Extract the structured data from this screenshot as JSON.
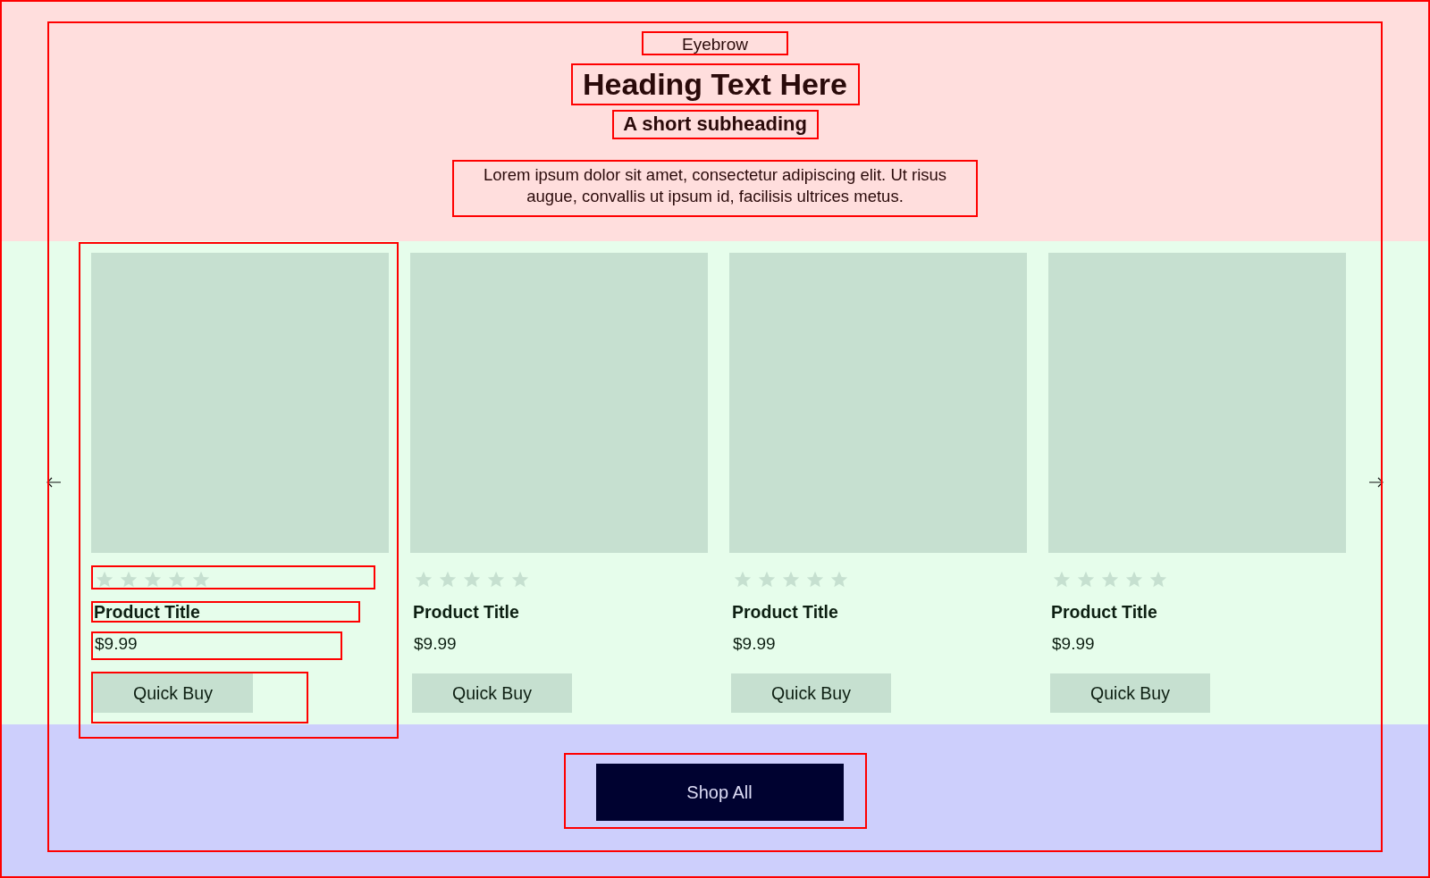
{
  "header": {
    "eyebrow": "Eyebrow",
    "heading": "Heading Text Here",
    "subheading": "A short subheading",
    "body": "Lorem ipsum dolor sit amet, consectetur adipiscing elit. Ut risus augue, convallis ut ipsum id, facilisis ultrices metus."
  },
  "products": [
    {
      "stars": 5,
      "title": "Product Title",
      "price": "$9.99",
      "button": "Quick Buy"
    },
    {
      "stars": 5,
      "title": "Product Title",
      "price": "$9.99",
      "button": "Quick Buy"
    },
    {
      "stars": 5,
      "title": "Product Title",
      "price": "$9.99",
      "button": "Quick Buy"
    },
    {
      "stars": 5,
      "title": "Product Title",
      "price": "$9.99",
      "button": "Quick Buy"
    }
  ],
  "footer": {
    "button": "Shop All"
  }
}
